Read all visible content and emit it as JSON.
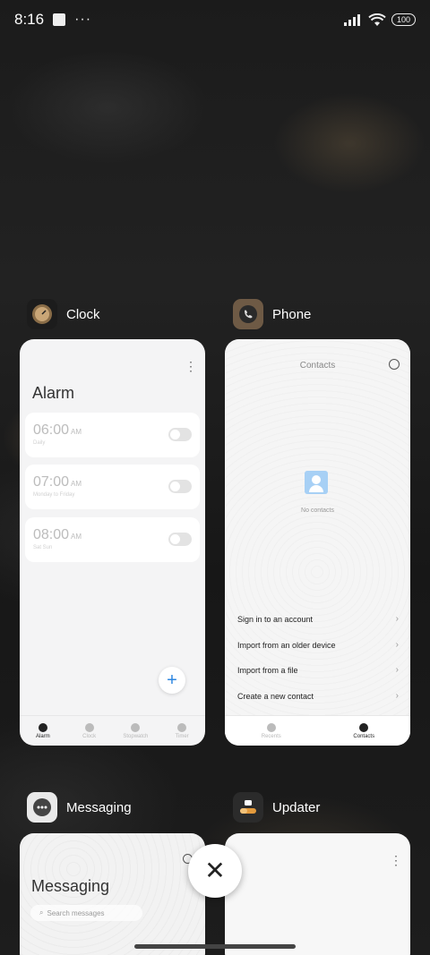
{
  "status_bar": {
    "time": "8:16",
    "notification_more": "···",
    "battery": "100",
    "icons": [
      "screenshot-notification-icon",
      "signal-icon",
      "wifi-icon",
      "battery-icon"
    ]
  },
  "recents": [
    {
      "app_name": "Clock",
      "icon": "clock-app-icon",
      "screen": {
        "title": "Alarm",
        "alarms": [
          {
            "time": "06:00",
            "ampm": "AM",
            "repeat": "Daily"
          },
          {
            "time": "07:00",
            "ampm": "AM",
            "repeat": "Monday to Friday"
          },
          {
            "time": "08:00",
            "ampm": "AM",
            "repeat": "Sat Sun"
          }
        ],
        "nav": [
          {
            "label": "Alarm",
            "icon": "alarm-icon",
            "active": true
          },
          {
            "label": "Clock",
            "icon": "clock-icon",
            "active": false
          },
          {
            "label": "Stopwatch",
            "icon": "stopwatch-icon",
            "active": false
          },
          {
            "label": "Timer",
            "icon": "timer-icon",
            "active": false
          }
        ]
      }
    },
    {
      "app_name": "Phone",
      "icon": "phone-app-icon",
      "screen": {
        "title": "Contacts",
        "empty_text": "No contacts",
        "actions": [
          "Sign in to an account",
          "Import from an older device",
          "Import from a file",
          "Create a new contact"
        ],
        "nav": [
          {
            "label": "Recents",
            "icon": "phone-icon",
            "active": false
          },
          {
            "label": "Contacts",
            "icon": "person-icon",
            "active": true
          }
        ]
      }
    },
    {
      "app_name": "Messaging",
      "icon": "messaging-app-icon",
      "screen": {
        "title": "Messaging",
        "search_placeholder": "Search messages"
      }
    },
    {
      "app_name": "Updater",
      "icon": "updater-app-icon",
      "screen": {}
    }
  ],
  "close_all_icon": "close-icon",
  "colors": {
    "accent_blue": "#2d86e0",
    "card_bg": "#f4f4f5"
  }
}
